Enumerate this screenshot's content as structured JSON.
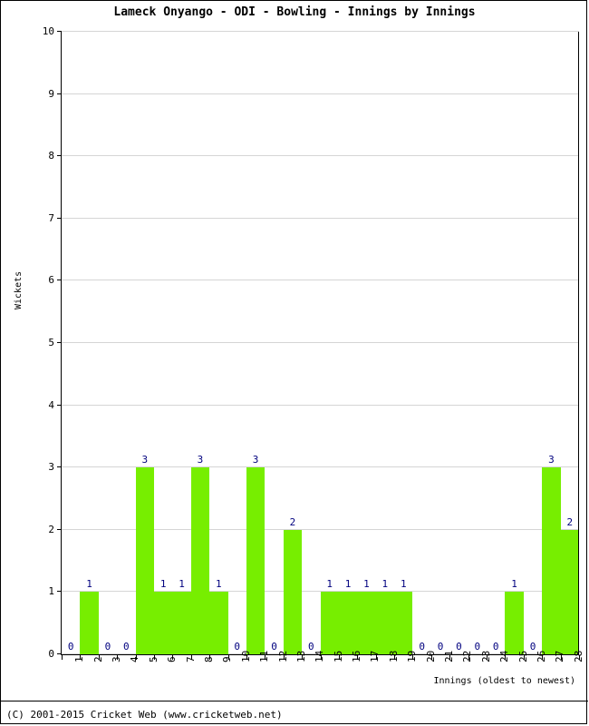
{
  "chart_data": {
    "type": "bar",
    "title": "Lameck Onyango - ODI - Bowling - Innings by Innings",
    "xlabel": "Innings (oldest to newest)",
    "ylabel": "Wickets",
    "categories": [
      "1",
      "2",
      "3",
      "4",
      "5",
      "6",
      "7",
      "8",
      "9",
      "10",
      "11",
      "12",
      "13",
      "14",
      "15",
      "16",
      "17",
      "18",
      "19",
      "20",
      "21",
      "22",
      "23",
      "24",
      "25",
      "26",
      "27",
      "28"
    ],
    "values": [
      0,
      1,
      0,
      0,
      3,
      1,
      1,
      3,
      1,
      0,
      3,
      0,
      2,
      0,
      1,
      1,
      1,
      1,
      1,
      0,
      0,
      0,
      0,
      0,
      1,
      0,
      3,
      2
    ],
    "value_labels": [
      "0",
      "1",
      "0",
      "0",
      "3",
      "1",
      "1",
      "3",
      "1",
      "0",
      "3",
      "0",
      "2",
      "0",
      "1",
      "1",
      "1",
      "1",
      "1",
      "0",
      "0",
      "0",
      "0",
      "0",
      "1",
      "0",
      "3",
      "2"
    ],
    "ylim": [
      0,
      10
    ],
    "yticks": [
      0,
      1,
      2,
      3,
      4,
      5,
      6,
      7,
      8,
      9,
      10
    ],
    "ytick_labels": [
      "0",
      "1",
      "2",
      "3",
      "4",
      "5",
      "6",
      "7",
      "8",
      "9",
      "10"
    ],
    "grid": true,
    "legend": false,
    "bar_color": "#77ee00",
    "value_label_color": "#00007f",
    "grid_color": "#d5d5d5",
    "axis_color": "#000000"
  },
  "footer": {
    "copyright": "(C) 2001-2015 Cricket Web (www.cricketweb.net)"
  }
}
